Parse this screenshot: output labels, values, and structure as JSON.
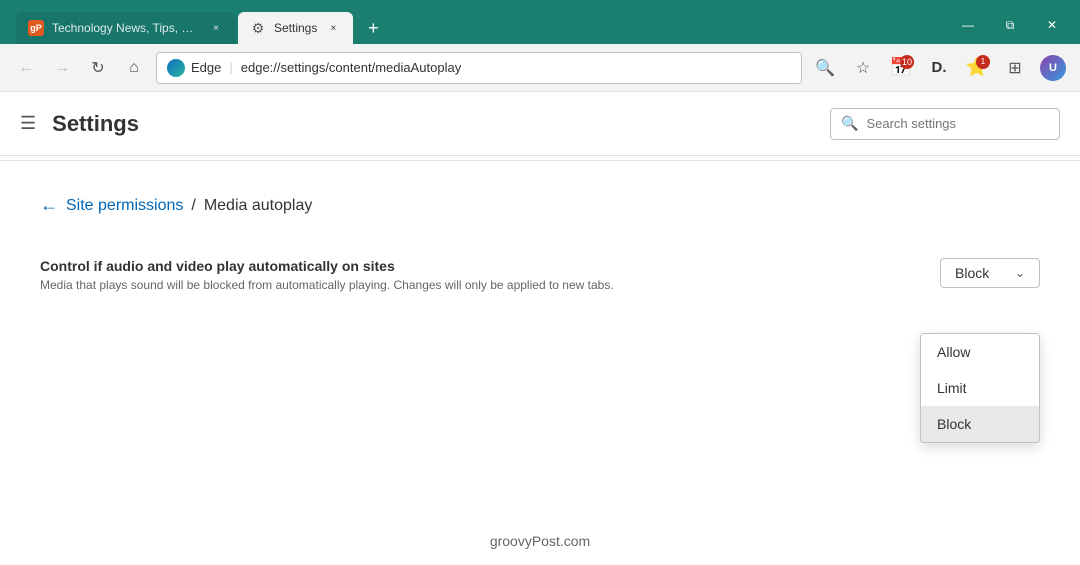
{
  "browser": {
    "tabs": [
      {
        "id": "tab-news",
        "favicon_type": "favicon-gp",
        "favicon_label": "gP",
        "title": "Technology News, Tips, Reviews,",
        "active": false,
        "close_label": "×"
      },
      {
        "id": "tab-settings",
        "favicon_type": "gear",
        "title": "Settings",
        "active": true,
        "close_label": "×"
      }
    ],
    "new_tab_label": "+",
    "window_controls": {
      "minimize": "—",
      "restore": "⧉",
      "close": "✕"
    },
    "address_bar": {
      "edge_label": "Edge",
      "separator": "|",
      "url": "edge://settings/content/mediaAutoplay",
      "url_protocol": "edge://",
      "url_path": "settings",
      "url_rest": "/content/mediaAutoplay"
    }
  },
  "toolbar_icons": {
    "search": "🔍",
    "favorites": "☆",
    "calendar_badge": "10",
    "d_icon": "D",
    "favorites2": "⭐",
    "collections": "⧉"
  },
  "settings": {
    "hamburger": "☰",
    "title": "Settings",
    "search_placeholder": "Search settings"
  },
  "breadcrumb": {
    "back_arrow": "←",
    "parent_label": "Site permissions",
    "separator": "/",
    "current_label": "Media autoplay"
  },
  "permission": {
    "title": "Control if audio and video play automatically on sites",
    "description": "Media that plays sound will be blocked from automatically playing. Changes will only be applied to new tabs.",
    "dropdown_selected": "Block",
    "dropdown_arrow": "⌄"
  },
  "dropdown_menu": {
    "items": [
      {
        "label": "Allow",
        "value": "allow"
      },
      {
        "label": "Limit",
        "value": "limit"
      },
      {
        "label": "Block",
        "value": "block",
        "selected": true
      }
    ]
  },
  "footer": {
    "text": "groovyPost.com"
  }
}
